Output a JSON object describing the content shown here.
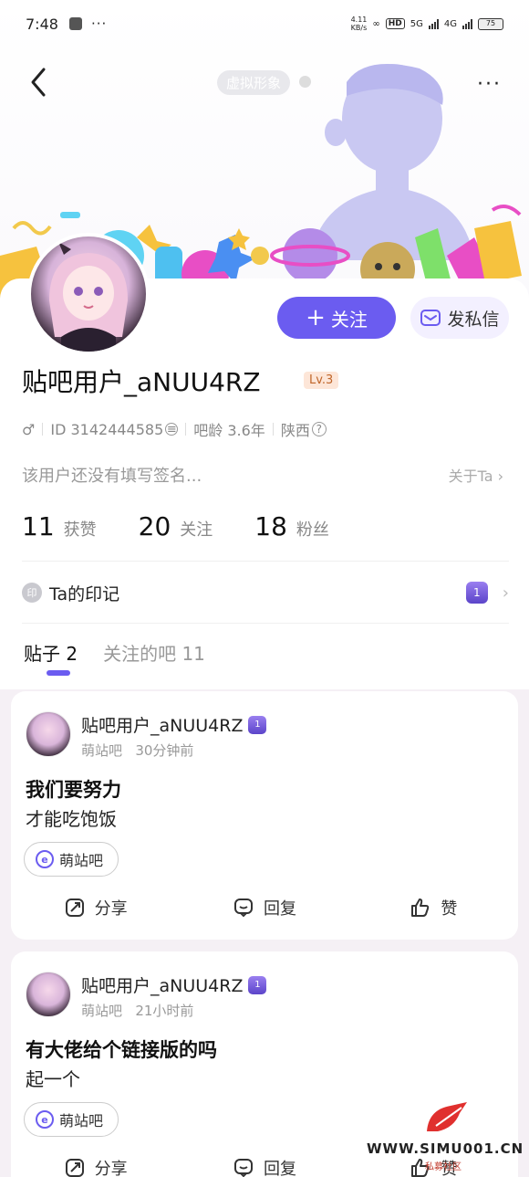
{
  "status_bar": {
    "time": "7:48",
    "dots": "···",
    "net_speed": "4.11\nKB/s",
    "hd": "HD",
    "sig1": "5G",
    "sig2": "4G",
    "battery": "75"
  },
  "header": {
    "virtual_label": "虚拟形象",
    "more": "···"
  },
  "profile": {
    "username": "贴吧用户_aNUU4RZ",
    "level": "Lv.3",
    "gender_icon": "♂",
    "id_text": "ID 3142444585",
    "age_text": "吧龄 3.6年",
    "region": "陕西",
    "signature": "该用户还没有填写签名...",
    "about": "关于Ta",
    "follow_label": "关注",
    "message_label": "发私信"
  },
  "stats": [
    {
      "num": "11",
      "label": "获赞"
    },
    {
      "num": "20",
      "label": "关注"
    },
    {
      "num": "18",
      "label": "粉丝"
    }
  ],
  "marks": {
    "icon_text": "印",
    "label": "Ta的印记",
    "badge": "1"
  },
  "tabs": [
    {
      "label": "贴子 2"
    },
    {
      "label": "关注的吧 11"
    }
  ],
  "posts": [
    {
      "user": "贴吧用户_aNUU4RZ",
      "badge": "1",
      "forum": "萌站吧",
      "time": "30分钟前",
      "title": "我们要努力",
      "body": "才能吃饱饭",
      "tag": "萌站吧",
      "share": "分享",
      "reply": "回复",
      "like": "赞"
    },
    {
      "user": "贴吧用户_aNUU4RZ",
      "badge": "1",
      "forum": "萌站吧",
      "time": "21小时前",
      "title": "有大佬给个链接版的吗",
      "body": "起一个",
      "tag": "萌站吧",
      "share": "分享",
      "reply": "回复",
      "like": "赞"
    }
  ],
  "watermark": {
    "text": "WWW.SIMU001.CN",
    "sub": "私募社区"
  },
  "colors": {
    "accent": "#6b5cf0",
    "background": "#f5f0f5"
  }
}
